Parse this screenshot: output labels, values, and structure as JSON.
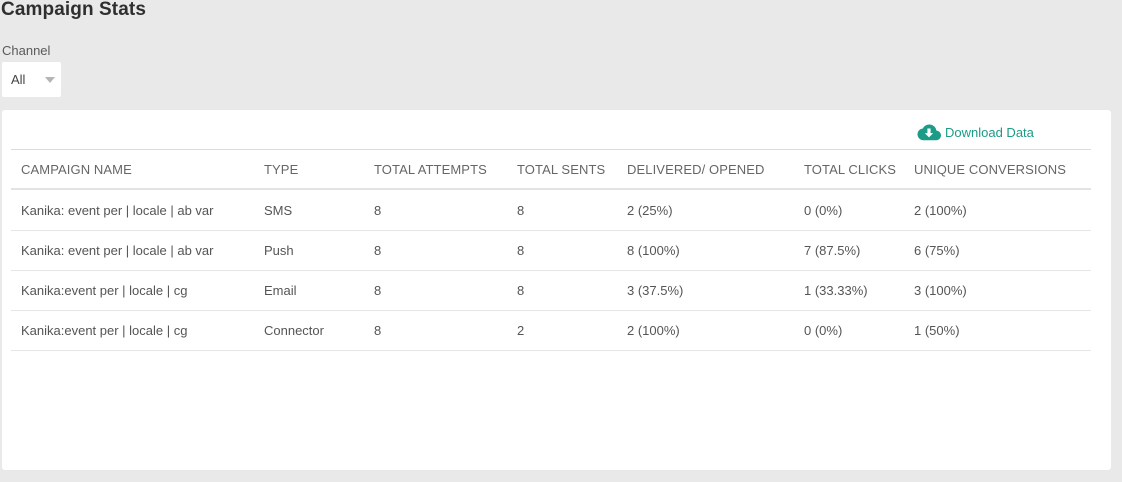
{
  "page": {
    "title": "Campaign Stats"
  },
  "filters": {
    "channel_label": "Channel",
    "channel_value": "All"
  },
  "actions": {
    "download_label": "Download Data",
    "download_icon": "cloud-download-icon",
    "accent_color": "#1c9b87"
  },
  "table": {
    "columns": [
      "CAMPAIGN NAME",
      "TYPE",
      "TOTAL ATTEMPTS",
      "TOTAL SENTS",
      "DELIVERED/ OPENED",
      "TOTAL CLICKS",
      "UNIQUE CONVERSIONS"
    ],
    "rows": [
      [
        "Kanika: event per | locale | ab var",
        "SMS",
        "8",
        "8",
        "2 (25%)",
        "0 (0%)",
        "2 (100%)"
      ],
      [
        "Kanika: event per | locale | ab var",
        "Push",
        "8",
        "8",
        "8 (100%)",
        "7 (87.5%)",
        "6 (75%)"
      ],
      [
        "Kanika:event per | locale | cg",
        "Email",
        "8",
        "8",
        "3 (37.5%)",
        "1 (33.33%)",
        "3 (100%)"
      ],
      [
        "Kanika:event per | locale | cg",
        "Connector",
        "8",
        "2",
        "2 (100%)",
        "0 (0%)",
        "1 (50%)"
      ]
    ]
  }
}
